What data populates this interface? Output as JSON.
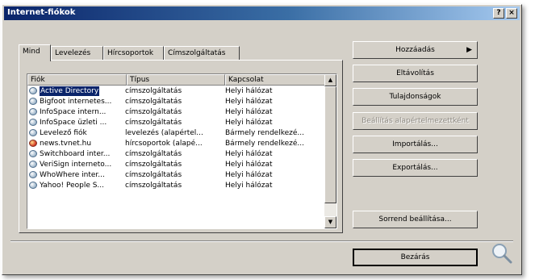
{
  "window": {
    "title": "Internet-fiókok",
    "help_glyph": "?",
    "close_glyph": "×"
  },
  "tabs": [
    {
      "label": "Mind"
    },
    {
      "label": "Levelezés"
    },
    {
      "label": "Hírcsoportok"
    },
    {
      "label": "Címszolgáltatás"
    }
  ],
  "table": {
    "headers": [
      "Fiók",
      "Típus",
      "Kapcsolat"
    ],
    "rows": [
      {
        "account": "Active Directory",
        "type": "címszolgáltatás",
        "connection": "Helyi hálózat"
      },
      {
        "account": "Bigfoot internetes...",
        "type": "címszolgáltatás",
        "connection": "Helyi hálózat"
      },
      {
        "account": "InfoSpace intern...",
        "type": "címszolgáltatás",
        "connection": "Helyi hálózat"
      },
      {
        "account": "InfoSpace üzleti ...",
        "type": "címszolgáltatás",
        "connection": "Helyi hálózat"
      },
      {
        "account": "Levelező fiók",
        "type": "levelezés (alapértel...",
        "connection": "Bármely rendelkezé..."
      },
      {
        "account": "news.tvnet.hu",
        "type": "hírcsoportok (alapé...",
        "connection": "Bármely rendelkezé..."
      },
      {
        "account": "Switchboard inter...",
        "type": "címszolgáltatás",
        "connection": "Helyi hálózat"
      },
      {
        "account": "VeriSign interneto...",
        "type": "címszolgáltatás",
        "connection": "Helyi hálózat"
      },
      {
        "account": "WhoWhere inter...",
        "type": "címszolgáltatás",
        "connection": "Helyi hálózat"
      },
      {
        "account": "Yahoo! People S...",
        "type": "címszolgáltatás",
        "connection": "Helyi hálózat"
      }
    ],
    "selected_index": 0
  },
  "buttons": {
    "add": "Hozzáadás",
    "remove": "Eltávolítás",
    "properties": "Tulajdonságok",
    "set_default": "Beállítás alapértelmezettként",
    "import": "Importálás...",
    "export": "Exportálás...",
    "order": "Sorrend beállítása...",
    "close": "Bezárás"
  },
  "icons": {
    "submenu_arrow": "▶",
    "scroll_up": "▲",
    "scroll_down": "▼"
  },
  "colors": {
    "titlebar_start": "#0a246a",
    "titlebar_end": "#a6caf0",
    "selection": "#0a246a",
    "face": "#d4d0c8"
  }
}
